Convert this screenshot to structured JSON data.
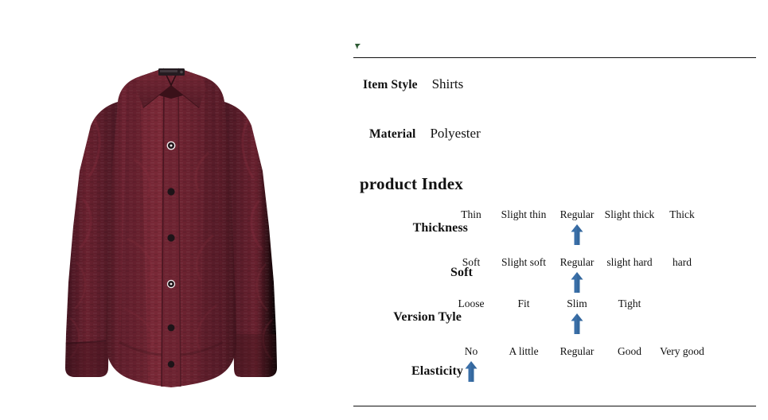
{
  "product_photo": {
    "alt": "burgundy textured long sleeve button-down dress shirt",
    "fabric_color": "#6b2231",
    "fabric_shadow": "#4a1722",
    "fabric_highlight": "#7d2b3b",
    "button_color": "#1d1418",
    "collar_tape_color": "#241b20"
  },
  "divider_color": "#111111",
  "attributes": [
    {
      "key": "Item Style",
      "value": "Shirts"
    },
    {
      "key": "Material",
      "value": "Polyester"
    }
  ],
  "section_title": "product Index",
  "arrow_color": "#3a6fa8",
  "arrow_color_dark": "#2f5c8d",
  "speck_color": "#2d5a33",
  "index_rows": [
    {
      "label": "Thickness",
      "options": [
        "Thin",
        "Slight thin",
        "Regular",
        "Slight thick",
        "Thick"
      ],
      "selected_index": 2
    },
    {
      "label": "Soft",
      "options": [
        "Soft",
        "Slight soft",
        "Regular",
        "slight hard",
        "hard"
      ],
      "selected_index": 2
    },
    {
      "label": "Version Tyle",
      "options": [
        "Loose",
        "Fit",
        "Slim",
        "Tight"
      ],
      "selected_index": 2
    },
    {
      "label": "Elasticity",
      "options": [
        "No",
        "A little",
        "Regular",
        "Good",
        "Very good"
      ],
      "selected_index": 0
    }
  ]
}
